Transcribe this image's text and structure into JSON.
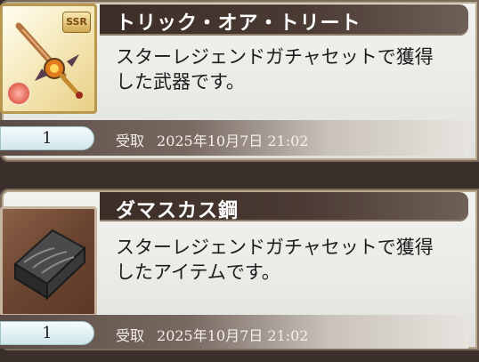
{
  "items": [
    {
      "title": "トリック・オア・トリート",
      "description": "スターレジェンドガチャセットで獲得\nした武器です。",
      "quantity": "1",
      "received_label": "受取",
      "received_date": "2025年10月7日 21:02",
      "icon": "ornate-sword-icon",
      "rarity": "SSR"
    },
    {
      "title": "ダマスカス鋼",
      "description": "スターレジェンドガチャセットで獲得\nしたアイテムです。",
      "quantity": "1",
      "received_label": "受取",
      "received_date": "2025年10月7日 21:02",
      "icon": "damascus-ingot-icon"
    }
  ],
  "colors": {
    "title_bar": "#3c2e27",
    "card_bg": "#eeeeea",
    "qty_pill": "#dcecef"
  }
}
